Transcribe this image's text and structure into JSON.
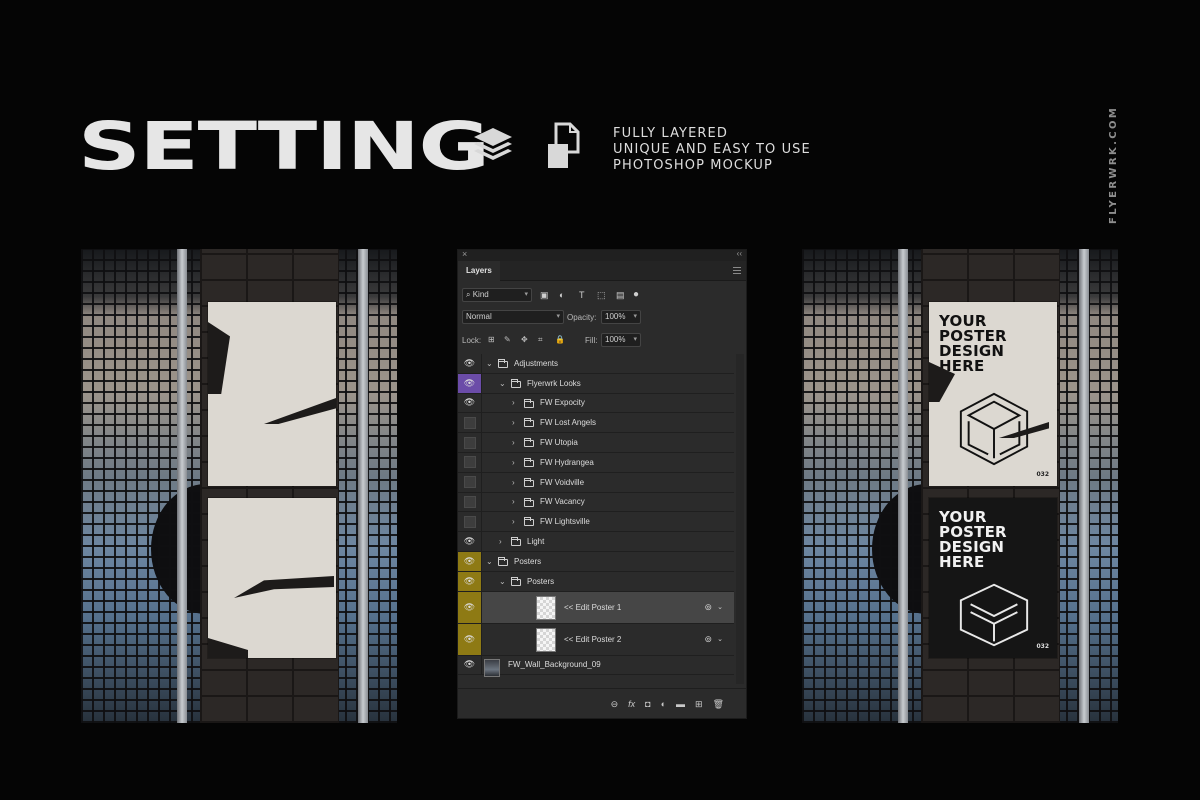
{
  "header": {
    "title": "SETTING",
    "tagline": [
      "FULLY LAYERED",
      "UNIQUE AND EASY TO USE",
      "PHOTOSHOP MOCKUP"
    ],
    "brand": "FLYERWRK.COM",
    "icons": [
      "layers-stack-icon",
      "file-copy-icon"
    ]
  },
  "mockup_right": {
    "poster_text": "YOUR POSTER DESIGN HERE",
    "poster_code": "032"
  },
  "layers_panel": {
    "tab": "Layers",
    "filter_kind": "Kind",
    "blend_mode": "Normal",
    "opacity_label": "Opacity:",
    "opacity_value": "100%",
    "lock_label": "Lock:",
    "fill_label": "Fill:",
    "fill_value": "100%",
    "layers": [
      {
        "name": "Adjustments",
        "type": "group",
        "expanded": true,
        "indent": 0,
        "visible": true,
        "color": "none"
      },
      {
        "name": "Flyerwrk Looks",
        "type": "group",
        "expanded": true,
        "indent": 1,
        "visible": true,
        "color": "purple"
      },
      {
        "name": "FW Expocity",
        "type": "group",
        "expanded": false,
        "indent": 2,
        "visible": true,
        "color": "none"
      },
      {
        "name": "FW Lost Angels",
        "type": "group",
        "expanded": false,
        "indent": 2,
        "visible": false,
        "color": "none"
      },
      {
        "name": "FW Utopia",
        "type": "group",
        "expanded": false,
        "indent": 2,
        "visible": false,
        "color": "none"
      },
      {
        "name": "FW Hydrangea",
        "type": "group",
        "expanded": false,
        "indent": 2,
        "visible": false,
        "color": "none"
      },
      {
        "name": "FW Voidville",
        "type": "group",
        "expanded": false,
        "indent": 2,
        "visible": false,
        "color": "none"
      },
      {
        "name": "FW Vacancy",
        "type": "group",
        "expanded": false,
        "indent": 2,
        "visible": false,
        "color": "none"
      },
      {
        "name": "FW Lightsville",
        "type": "group",
        "expanded": false,
        "indent": 2,
        "visible": false,
        "color": "none"
      },
      {
        "name": "Light",
        "type": "group",
        "expanded": false,
        "indent": 1,
        "visible": true,
        "color": "none"
      },
      {
        "name": "Posters",
        "type": "group",
        "expanded": true,
        "indent": 0,
        "visible": true,
        "color": "yellow"
      },
      {
        "name": "Posters",
        "type": "group",
        "expanded": true,
        "indent": 1,
        "visible": true,
        "color": "yellow"
      },
      {
        "name": "<< Edit Poster 1",
        "type": "smart",
        "indent": 2,
        "visible": true,
        "color": "yellow",
        "selected": true
      },
      {
        "name": "<< Edit Poster 2",
        "type": "smart",
        "indent": 2,
        "visible": true,
        "color": "yellow"
      },
      {
        "name": "FW_Wall_Background_09",
        "type": "image",
        "indent": 0,
        "visible": true,
        "color": "none"
      }
    ],
    "bottom_icons": [
      "link-icon",
      "fx-icon",
      "mask-icon",
      "adjustment-icon",
      "new-group-icon",
      "new-layer-icon",
      "delete-icon"
    ],
    "bottom_glyphs": [
      "⊖",
      "fx",
      "◘",
      "◐",
      "▬",
      "⊞",
      "🗑"
    ]
  },
  "colors": {
    "background": "#050505",
    "panel": "#2b2b2b",
    "purple_tag": "#6b4ca8",
    "yellow_tag": "#8e7a14"
  }
}
